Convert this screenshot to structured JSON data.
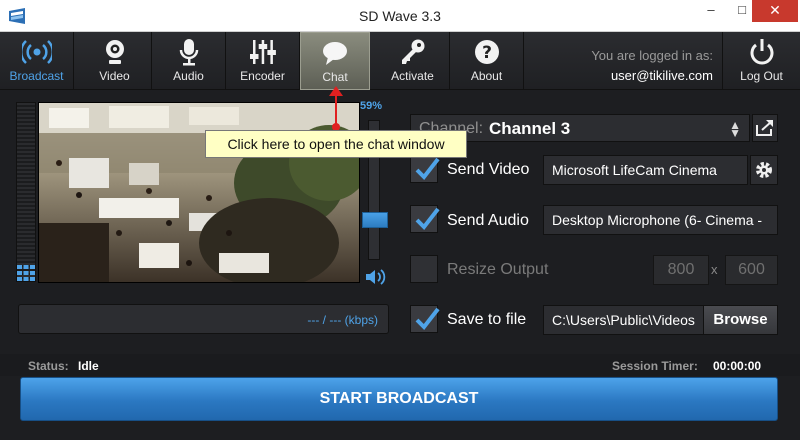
{
  "window": {
    "title": "SD Wave 3.3",
    "minimize": "–",
    "maximize": "□",
    "close": "✕"
  },
  "toolbar": {
    "items": [
      {
        "label": "Broadcast",
        "icon": "broadcast-icon"
      },
      {
        "label": "Video",
        "icon": "webcam-icon"
      },
      {
        "label": "Audio",
        "icon": "microphone-icon"
      },
      {
        "label": "Encoder",
        "icon": "sliders-icon"
      },
      {
        "label": "Chat",
        "icon": "chat-bubble-icon"
      },
      {
        "label": "Activate",
        "icon": "key-icon"
      },
      {
        "label": "About",
        "icon": "question-icon"
      }
    ],
    "login_line1": "You are logged in as:",
    "login_user": "user@tikilive.com",
    "logout_label": "Log Out"
  },
  "preview": {
    "volume_percent": "59%",
    "bitrate": "--- / --- (kbps)"
  },
  "tooltip": {
    "text": "Click here to open the chat window"
  },
  "channel": {
    "label": "Channel:",
    "value": "Channel 3"
  },
  "options": {
    "send_video": {
      "label": "Send Video",
      "checked": true,
      "value": "Microsoft LifeCam Cinema"
    },
    "send_audio": {
      "label": "Send Audio",
      "checked": true,
      "value": "Desktop Microphone (6- Cinema - "
    },
    "resize_output": {
      "label": "Resize Output",
      "checked": false,
      "width": "800",
      "x": "x",
      "height": "600"
    },
    "save_to_file": {
      "label": "Save to file",
      "checked": true,
      "value": "C:\\Users\\Public\\Videos",
      "browse_label": "Browse"
    }
  },
  "status": {
    "label": "Status:",
    "value": "Idle",
    "timer_label": "Session Timer:",
    "timer_value": "00:00:00"
  },
  "start_button": {
    "label": "START BROADCAST"
  },
  "colors": {
    "accent": "#4fa3e8",
    "background": "#1d1e21",
    "tooltip": "#ffffc4",
    "close": "#c8392d"
  }
}
